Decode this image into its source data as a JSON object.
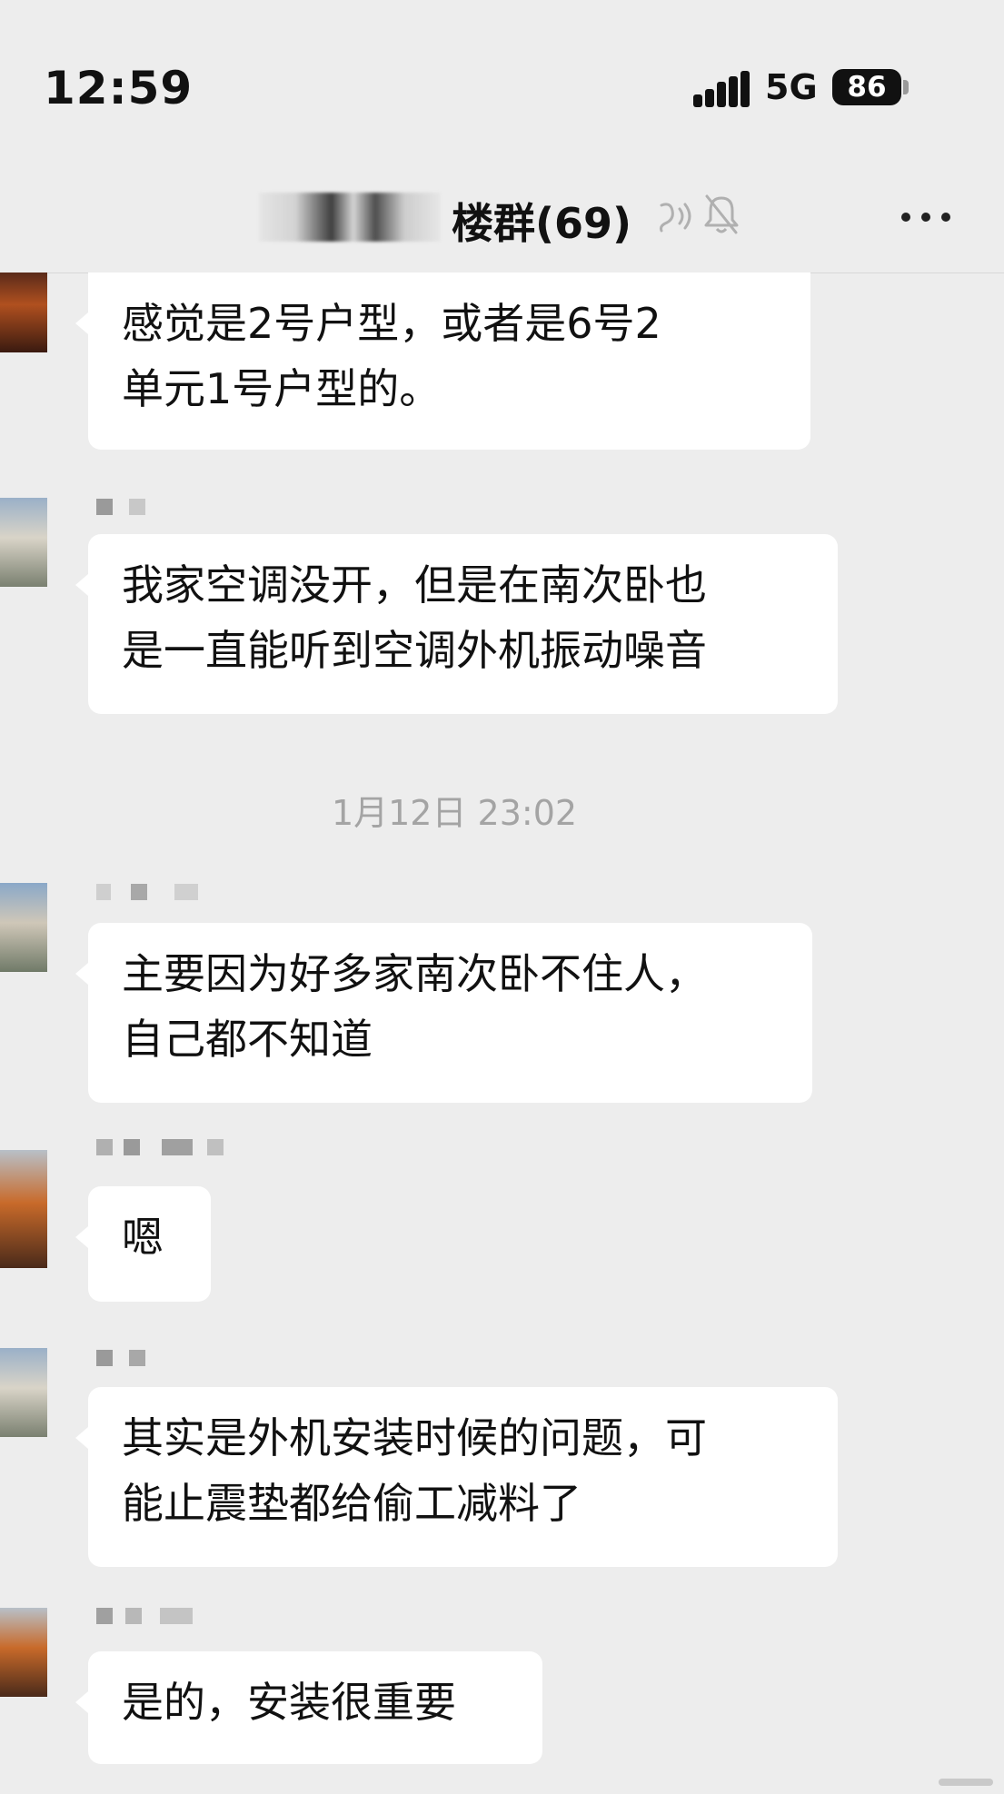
{
  "status_bar": {
    "time": "12:59",
    "network": "5G",
    "battery": "86"
  },
  "header": {
    "title": "楼群(69)"
  },
  "timestamp": "1月12日 23:02",
  "messages": [
    {
      "text": "感觉是2号户型，或者是6号2\n单元1号户型的。"
    },
    {
      "text": "我家空调没开，但是在南次卧也\n是一直能听到空调外机振动噪音"
    },
    {
      "text": "主要因为好多家南次卧不住人，\n自己都不知道"
    },
    {
      "text": "嗯"
    },
    {
      "text": "其实是外机安装时候的问题，可\n能止震垫都给偷工减料了"
    },
    {
      "text": "是的，安装很重要"
    }
  ],
  "colors": {
    "background": "#ededed",
    "bubble": "#ffffff",
    "text": "#111111",
    "timestamp": "#a4a4a4"
  }
}
